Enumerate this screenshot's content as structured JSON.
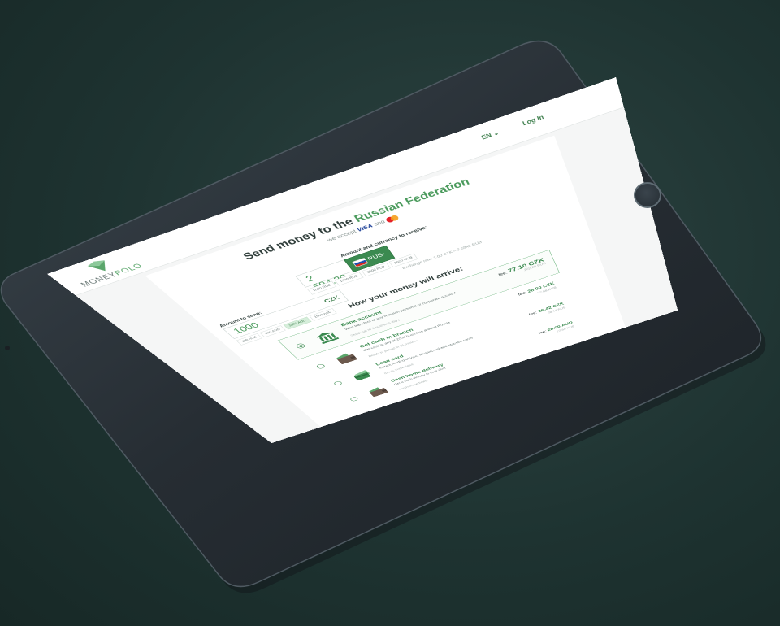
{
  "header": {
    "logo_left": "MONEY",
    "logo_right": "POLO",
    "language": "EN",
    "login": "Log In"
  },
  "hero": {
    "title_prefix": "Send money to the",
    "country": "Russian Federation",
    "accept_prefix": "we accept",
    "visa": "VISA",
    "and": "and"
  },
  "send": {
    "label": "Amount to send:",
    "value": "1000",
    "currency": "CZK",
    "presets": [
      "100 AUD",
      "500 AUD",
      "1000 AUD",
      "1500 AUD"
    ],
    "active_preset_index": 2
  },
  "receive": {
    "label": "Amount and currency to receive:",
    "value": "2 594.20",
    "currency": "RUB",
    "presets": [
      "1000 RUB",
      "1500 RUB",
      "2000 RUB",
      "2500 RUB"
    ]
  },
  "exchange_rate": "Exchange rate: 1.00 CZK = 2.5942 RUB",
  "section_title": "How your money will arrive:",
  "options": [
    {
      "title": "Bank account",
      "description": "Wire transfers to any Russian personal or corporate account",
      "time": "Sends up to 3 business days",
      "fee_label": "fee:",
      "fee": "77.10 CZK",
      "date": "202.28 RUB",
      "selected": true,
      "icon": "bank-icon"
    },
    {
      "title": "Get cash in branch",
      "description": "Get cash in any of 2000 branches around Russia",
      "time": "Ready to pickup in 15 minutes",
      "fee_label": "fee:",
      "fee": "28.00 CZK",
      "date": "72.68 RUB",
      "selected": false,
      "icon": "wallet-icon"
    },
    {
      "title": "Load card",
      "description": "Instant funding of Visa, MasterCard and Maestro cards",
      "time": "Sends immediately",
      "fee_label": "fee:",
      "fee": "26.42 CZK",
      "date": "68.54 RUB",
      "selected": false,
      "icon": "card-icon"
    },
    {
      "title": "Cash home delivery",
      "description": "Get a cash directly to your door",
      "time": "Sends immediately",
      "fee_label": "fee:",
      "fee": "28.00 AUD",
      "date": "72.68 RUB",
      "selected": false,
      "icon": "wallet-icon"
    }
  ],
  "colors": {
    "brand_green": "#3b8a50",
    "accent_green": "#4a9a5c",
    "background": "#1e3331"
  }
}
